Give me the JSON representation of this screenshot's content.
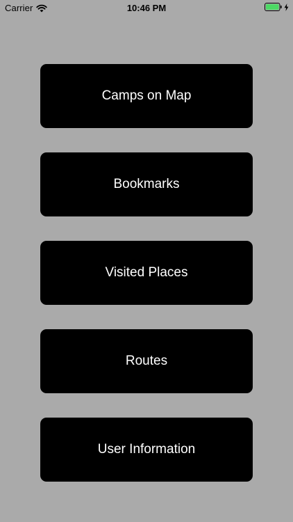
{
  "status_bar": {
    "carrier": "Carrier",
    "time": "10:46 PM",
    "battery_color": "#4cd964"
  },
  "menu": {
    "items": [
      {
        "label": "Camps on Map"
      },
      {
        "label": "Bookmarks"
      },
      {
        "label": "Visited Places"
      },
      {
        "label": "Routes"
      },
      {
        "label": "User Information"
      }
    ]
  }
}
